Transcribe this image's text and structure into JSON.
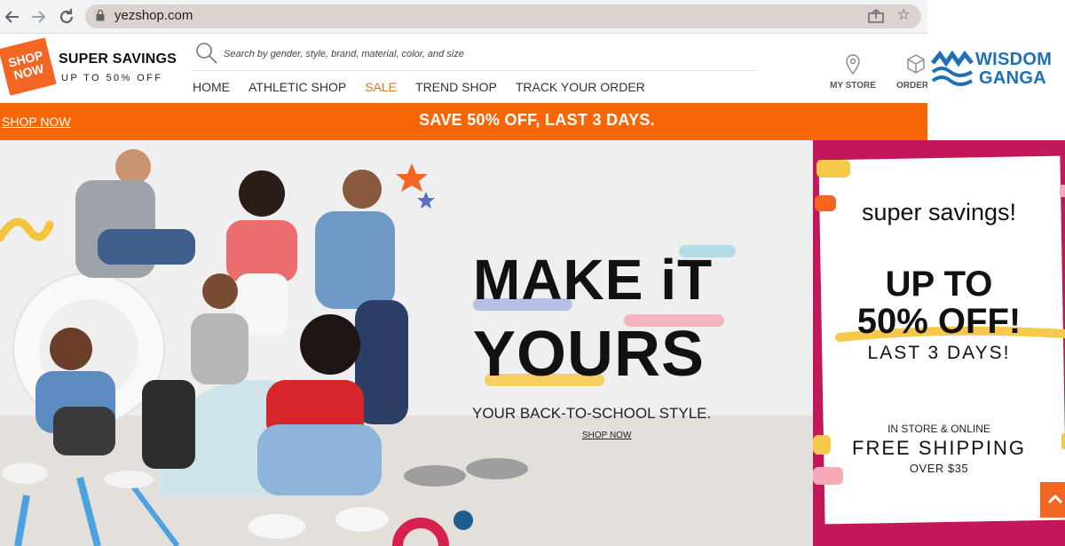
{
  "browser": {
    "url": "yezshop.com",
    "back_icon": "arrow-left-icon",
    "forward_icon": "arrow-right-icon",
    "reload_icon": "reload-icon"
  },
  "header": {
    "logo_text": "SHOP NOW",
    "tagline_main": "SUPER SAVINGS",
    "tagline_sub": "UP TO 50% OFF",
    "search_placeholder": "Search by gender, style, brand, material, color, and size",
    "menu": [
      {
        "label": "HOME"
      },
      {
        "label": "ATHLETIC SHOP"
      },
      {
        "label": "SALE"
      },
      {
        "label": "TREND SHOP"
      },
      {
        "label": "TRACK YOUR ORDER"
      }
    ],
    "my_store_label": "MY STORE",
    "orders_label": "ORDER"
  },
  "watermark": {
    "line1": "WISDOM",
    "line2": "GANGA"
  },
  "promo": {
    "link": "SHOP NOW",
    "message": "SAVE 50% OFF, LAST 3 DAYS."
  },
  "hero": {
    "title_line1": "MAKE iT",
    "title_line2": "YOURS",
    "subtitle": "YOUR BACK-TO-SCHOOL STYLE.",
    "cta": "SHOP NOW"
  },
  "side_ad": {
    "line1": "super savings!",
    "line2": "UP TO",
    "line3": "50% OFF!",
    "line4": "LAST 3 DAYS!",
    "line5": "IN STORE & ONLINE",
    "line6": "FREE SHIPPING",
    "line7": "OVER $35"
  },
  "colors": {
    "brand_orange": "#f76707",
    "sale_orange": "#e8731f",
    "ad_magenta": "#c2185b"
  }
}
